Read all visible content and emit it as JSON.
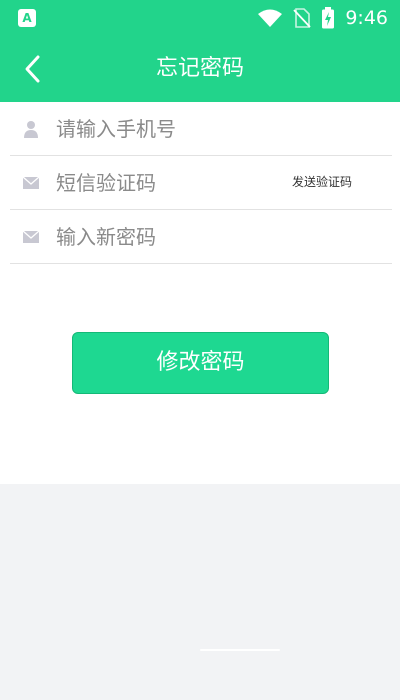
{
  "status_bar": {
    "time": "9:46",
    "app_icon_letter": "A",
    "icons": [
      "wifi-icon",
      "no-sim-icon",
      "battery-charging-icon"
    ]
  },
  "header": {
    "title": "忘记密码",
    "back_icon": "chevron-left-icon"
  },
  "form": {
    "phone": {
      "placeholder": "请输入手机号",
      "value": "",
      "icon": "user-icon"
    },
    "code": {
      "placeholder": "短信验证码",
      "value": "",
      "icon": "mail-icon",
      "send_label": "发送验证码"
    },
    "new_password": {
      "placeholder": "输入新密码",
      "value": "",
      "icon": "mail-icon"
    }
  },
  "submit_label": "修改密码",
  "colors": {
    "brand": "#22d48b",
    "button": "#1ed891",
    "icon_gray": "#c8c8d2",
    "background": "#f2f3f5"
  }
}
